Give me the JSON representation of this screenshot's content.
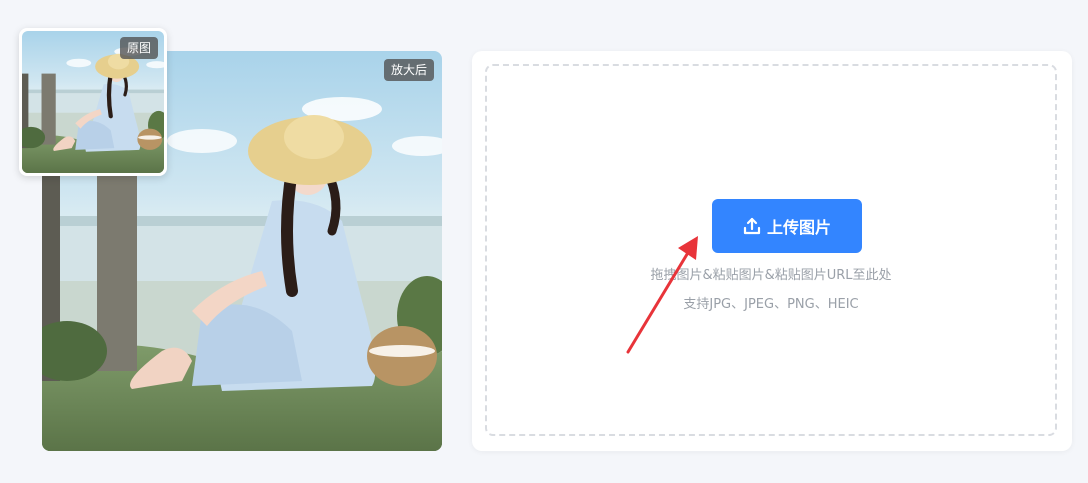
{
  "comparison": {
    "after_label": "放大后",
    "original_label": "原图"
  },
  "upload": {
    "button_label": "上传图片",
    "button_icon": "upload-icon",
    "hint_line1": "拖拽图片&粘贴图片&粘贴图片URL至此处",
    "hint_line2": "支持JPG、JPEG、PNG、HEIC"
  },
  "colors": {
    "accent": "#3385ff",
    "arrow": "#e8343a"
  }
}
